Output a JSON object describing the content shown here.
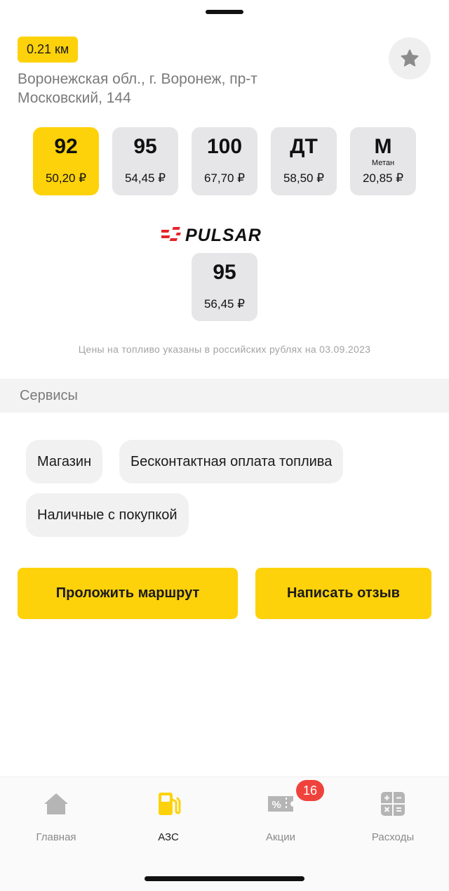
{
  "station": {
    "distance": "0.21 км",
    "address": "Воронежская обл., г. Воронеж, пр-т Московский, 144"
  },
  "fuels": [
    {
      "grade": "92",
      "sub": "",
      "price": "50,20 ₽",
      "active": true
    },
    {
      "grade": "95",
      "sub": "",
      "price": "54,45 ₽",
      "active": false
    },
    {
      "grade": "100",
      "sub": "",
      "price": "67,70 ₽",
      "active": false
    },
    {
      "grade": "ДТ",
      "sub": "",
      "price": "58,50 ₽",
      "active": false
    },
    {
      "grade": "М",
      "sub": "Метан",
      "price": "20,85 ₽",
      "active": false
    }
  ],
  "brand_fuel": {
    "logo_text": "PULSAR",
    "grade": "95",
    "price": "56,45 ₽"
  },
  "price_note": "Цены на топливо указаны в российских рублях на 03.09.2023",
  "services": {
    "title": "Сервисы",
    "items": [
      "Магазин",
      "Бесконтактная оплата топлива",
      "Наличные с покупкой"
    ]
  },
  "actions": {
    "route": "Проложить маршрут",
    "review": "Написать отзыв"
  },
  "tabs": [
    {
      "label": "Главная",
      "icon": "home-icon"
    },
    {
      "label": "АЗС",
      "icon": "fuel-pump-icon"
    },
    {
      "label": "Акции",
      "icon": "discount-ticket-icon"
    },
    {
      "label": "Расходы",
      "icon": "calculator-icon"
    }
  ],
  "promo_badge": "16",
  "colors": {
    "accent": "#fdd20a",
    "badge": "#f0423c",
    "brand_red": "#e3262a"
  }
}
